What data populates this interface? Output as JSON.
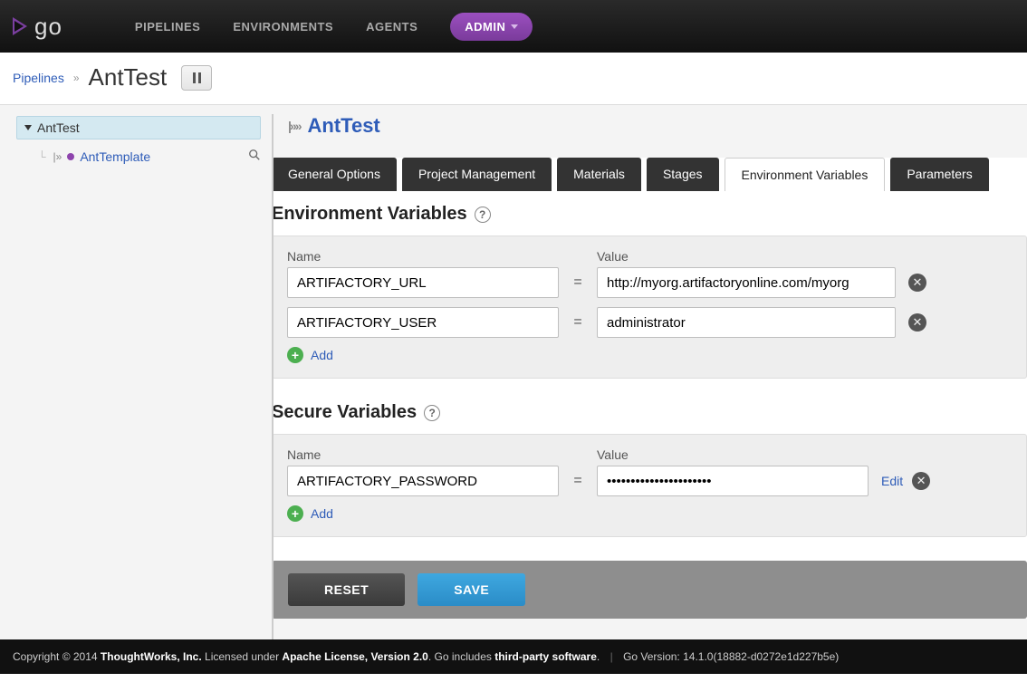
{
  "nav": {
    "items": [
      "PIPELINES",
      "ENVIRONMENTS",
      "AGENTS"
    ],
    "active": "ADMIN",
    "logo": "go"
  },
  "breadcrumb": {
    "root": "Pipelines",
    "sep": "»",
    "title": "AntTest"
  },
  "tree": {
    "node": "AntTest",
    "child": "AntTemplate"
  },
  "pane": {
    "title": "AntTest"
  },
  "tabs": [
    "General Options",
    "Project Management",
    "Materials",
    "Stages",
    "Environment Variables",
    "Parameters"
  ],
  "active_tab_index": 4,
  "env_section": {
    "title": "Environment Variables",
    "name_header": "Name",
    "value_header": "Value",
    "rows": [
      {
        "name": "ARTIFACTORY_URL",
        "value": "http://myorg.artifactoryonline.com/myorg"
      },
      {
        "name": "ARTIFACTORY_USER",
        "value": "administrator"
      }
    ],
    "add_label": "Add"
  },
  "secure_section": {
    "title": "Secure Variables",
    "name_header": "Name",
    "value_header": "Value",
    "rows": [
      {
        "name": "ARTIFACTORY_PASSWORD",
        "value": "••••••••••••••••••••••",
        "edit_label": "Edit"
      }
    ],
    "add_label": "Add"
  },
  "actions": {
    "reset": "RESET",
    "save": "SAVE"
  },
  "footer": {
    "copyright_prefix": "Copyright © 2014 ",
    "company": "ThoughtWorks, Inc.",
    "licensed_prefix": " Licensed under ",
    "license": "Apache License, Version 2.0",
    "includes_prefix": ". Go includes ",
    "third_party": "third-party software",
    "version_label": "Go Version: ",
    "version": "14.1.0(18882-d0272e1d227b5e)"
  }
}
